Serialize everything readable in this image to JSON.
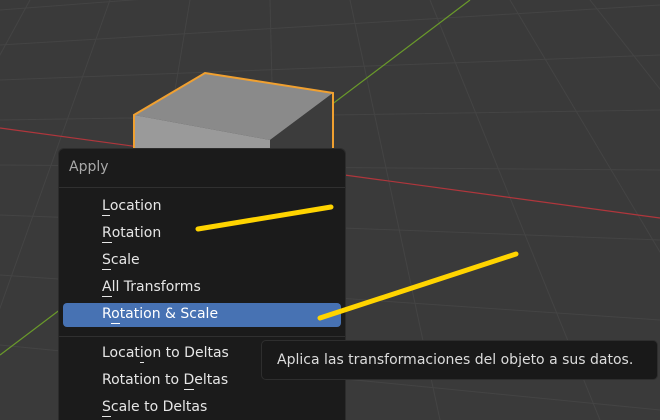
{
  "menu": {
    "title": "Apply",
    "items": [
      {
        "pre": "",
        "ul": "L",
        "post": "ocation"
      },
      {
        "pre": "",
        "ul": "R",
        "post": "otation"
      },
      {
        "pre": "",
        "ul": "S",
        "post": "cale"
      },
      {
        "pre": "",
        "ul": "A",
        "post": "ll Transforms"
      },
      {
        "pre": "R",
        "ul": "o",
        "post": "tation & Scale",
        "active": true
      },
      {
        "pre": "Locat",
        "ul": "i",
        "post": "on to Deltas"
      },
      {
        "pre": "Rotation to ",
        "ul": "D",
        "post": "eltas"
      },
      {
        "pre": "",
        "ul": "S",
        "post": "cale to Deltas"
      }
    ]
  },
  "tooltip": {
    "text": "Aplica las transformaciones del objeto a sus datos."
  },
  "colors": {
    "viewport_bg": "#3a3a3a",
    "selection_outline": "#f0a030",
    "highlight": "#4772b3",
    "annotation": "#ffd400",
    "x_axis": "#b0363c",
    "y_axis": "#6a9a2a"
  }
}
